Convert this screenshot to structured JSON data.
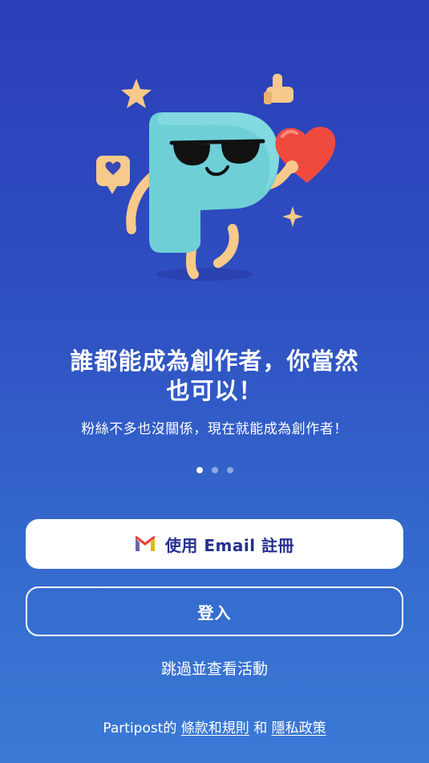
{
  "onboarding": {
    "headline_line1": "誰都能成為創作者，你當然",
    "headline_line2": "也可以！",
    "subtitle": "粉絲不多也沒關係，現在就能成為創作者！",
    "page_indicator": {
      "total": 3,
      "active": 1
    }
  },
  "actions": {
    "email_signup_label": "使用 Email 註冊",
    "login_label": "登入",
    "skip_label": "跳過並查看活動"
  },
  "footer": {
    "prefix": "Partipost的",
    "terms_label": "條款和規則",
    "conjunction": "和",
    "privacy_label": "隱私政策"
  },
  "icons": {
    "email": "gmail-icon",
    "hero": "mascot-illustration"
  },
  "colors": {
    "background_top": "#2a3db8",
    "background_bottom": "#3a7ad6",
    "primary_button_text": "#25308f",
    "mascot": "#6ed0d6",
    "heart": "#f04a3e",
    "accent_gold": "#f7c98a"
  }
}
